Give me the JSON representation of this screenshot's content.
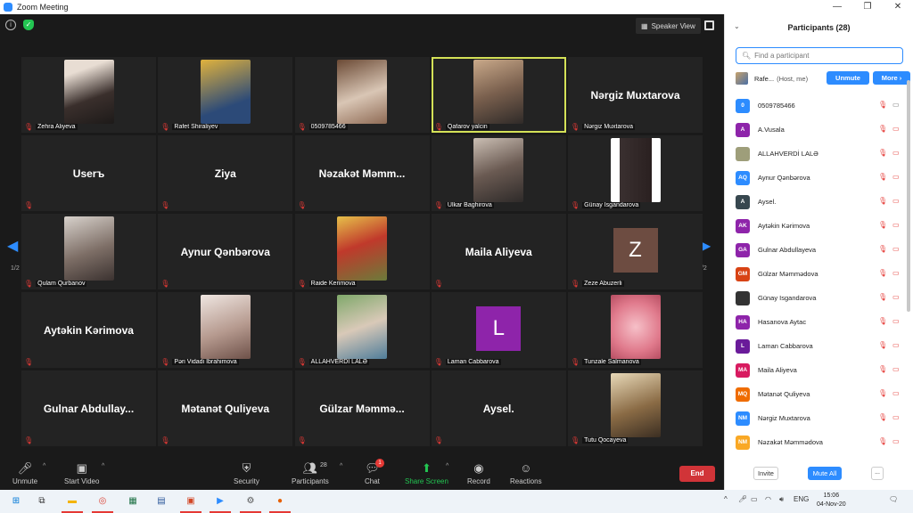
{
  "window": {
    "title": "Zoom Meeting",
    "minimize": "—",
    "maximize": "❐",
    "close": "✕"
  },
  "meeting": {
    "info_icon": "i",
    "shield_icon": "✓",
    "speaker_view_label": "Speaker View",
    "page_left": "1/2",
    "page_right": "1/2",
    "tiles": [
      {
        "name": "Zehra Aliyeva",
        "type": "video",
        "bg": "linear-gradient(160deg,#e8ddd3 20%,#3a2f2c 60%,#1d1a19)"
      },
      {
        "name": "Rafet Shiraliyev",
        "type": "video",
        "bg": "linear-gradient(160deg,#e0b23d,#2c4a78 70%)"
      },
      {
        "name": "0509785466",
        "type": "video",
        "bg": "linear-gradient(160deg,#6b4a35,#d9c6b5 55%,#8f6b55)"
      },
      {
        "name": "Qafarov yalcin",
        "type": "video",
        "bg": "linear-gradient(160deg,#c9a98a,#7a604e 50%,#2f2a28)",
        "active": true
      },
      {
        "name": "Nərgiz Muxtarova",
        "type": "name",
        "big": "Nərgiz Muxtarova"
      },
      {
        "name": "",
        "type": "name",
        "big": "Userъ"
      },
      {
        "name": "",
        "type": "name",
        "big": "Ziya"
      },
      {
        "name": "",
        "type": "name",
        "big": "Nəzakət Məmm..."
      },
      {
        "name": "Ulkar Baghirova",
        "type": "video",
        "bg": "linear-gradient(160deg,#cbbfb4,#6a5a52 50%,#2e2a29)"
      },
      {
        "name": "Günay Isgandarova",
        "type": "video",
        "bg": "linear-gradient(90deg,#fff 18%,#3a3030 18%,#2a2020 82%,#fff 82%)"
      },
      {
        "name": "Qulam Qurbanov",
        "type": "video",
        "bg": "linear-gradient(160deg,#d8d2cc,#7d6e66 55%,#3b3230)"
      },
      {
        "name": "",
        "type": "name",
        "big": "Aynur Qənbərova"
      },
      {
        "name": "Raide Kerimova",
        "type": "photo",
        "bg": "linear-gradient(160deg,#e6c14a,#c0392b 45%,#6b7b3a)"
      },
      {
        "name": "",
        "type": "name",
        "big": "Maila Aliyeva"
      },
      {
        "name": "Zeze Abuzerli",
        "type": "letter",
        "letter": "Z",
        "color": "#6d4c41"
      },
      {
        "name": "",
        "type": "name",
        "big": "Aytəkin Kərimova"
      },
      {
        "name": "Pəri Vidadi İbrahimova",
        "type": "photo",
        "bg": "linear-gradient(160deg,#efe6e1,#b69a8f 55%,#6e5149)"
      },
      {
        "name": "ALLAHVERDİ LALƏ",
        "type": "photo",
        "bg": "linear-gradient(160deg,#7fa86a,#d9c9b8 50%,#4f7d9a)"
      },
      {
        "name": "Laman Cabbarova",
        "type": "letter",
        "letter": "L",
        "color": "#8e24aa"
      },
      {
        "name": "Tunzale Salmanova",
        "type": "photo",
        "bg": "radial-gradient(circle,#f6c0c8,#e07a8c 60%,#b74e62)"
      },
      {
        "name": "",
        "type": "name",
        "big": "Gulnar Abdullay..."
      },
      {
        "name": "",
        "type": "name",
        "big": "Mətanət Quliyeva"
      },
      {
        "name": "",
        "type": "name",
        "big": "Gülzar Məmmə..."
      },
      {
        "name": "",
        "type": "name",
        "big": "Aysel."
      },
      {
        "name": "Tutu Qocayeva",
        "type": "photo",
        "bg": "linear-gradient(160deg,#e8d9b8,#8a6b45 55%,#3b2e22)"
      }
    ]
  },
  "toolbar": {
    "unmute": "Unmute",
    "start_video": "Start Video",
    "security": "Security",
    "participants": "Participants",
    "participant_count": "28",
    "chat": "Chat",
    "chat_badge": "1",
    "share_screen": "Share Screen",
    "record": "Record",
    "reactions": "Reactions",
    "end": "End"
  },
  "panel": {
    "title": "Participants (28)",
    "search_placeholder": "Find a participant",
    "host": {
      "name": "Rafe...",
      "role": "(Host, me)",
      "unmute": "Unmute",
      "more": "More ›"
    },
    "participants": [
      {
        "initials": "0",
        "name": "0509785466",
        "color": "#2d8cff",
        "video": true
      },
      {
        "initials": "A",
        "name": "A.Vusala",
        "color": "#8e24aa",
        "video": false
      },
      {
        "initials": "",
        "name": "ALLAHVERDİ LALƏ",
        "color": "#9e9e7a",
        "video": false
      },
      {
        "initials": "AQ",
        "name": "Aynur Qənbərova",
        "color": "#2d8cff",
        "video": false
      },
      {
        "initials": "A",
        "name": "Aysel.",
        "color": "#37474f",
        "video": false
      },
      {
        "initials": "AK",
        "name": "Aytəkin Kərimova",
        "color": "#8e24aa",
        "video": false
      },
      {
        "initials": "GA",
        "name": "Gulnar Abdullayeva",
        "color": "#8e24aa",
        "video": false
      },
      {
        "initials": "GM",
        "name": "Gülzar Məmmədova",
        "color": "#d84315",
        "video": false
      },
      {
        "initials": "",
        "name": "Günay Isgandarova",
        "color": "#333333",
        "video": false
      },
      {
        "initials": "HA",
        "name": "Hasanova Aytac",
        "color": "#8e24aa",
        "video": false
      },
      {
        "initials": "L",
        "name": "Laman Cabbarova",
        "color": "#6a1b9a",
        "video": false
      },
      {
        "initials": "MA",
        "name": "Maila Aliyeva",
        "color": "#d81b60",
        "video": false
      },
      {
        "initials": "MQ",
        "name": "Mətanət Quliyeva",
        "color": "#ef6c00",
        "video": false
      },
      {
        "initials": "NM",
        "name": "Nərgiz Muxtarova",
        "color": "#2d8cff",
        "video": false
      },
      {
        "initials": "NM",
        "name": "Nəzakət Məmmədova",
        "color": "#f9a825",
        "video": false
      }
    ],
    "invite": "Invite",
    "mute_all": "Mute All",
    "more": "..."
  },
  "taskbar": {
    "language": "ENG",
    "time": "15:06",
    "date": "04-Nov-20"
  },
  "colors": {
    "accent": "#2d8cff",
    "end": "#d13438",
    "active_speaker": "#d4e157",
    "muted": "#e53935"
  }
}
